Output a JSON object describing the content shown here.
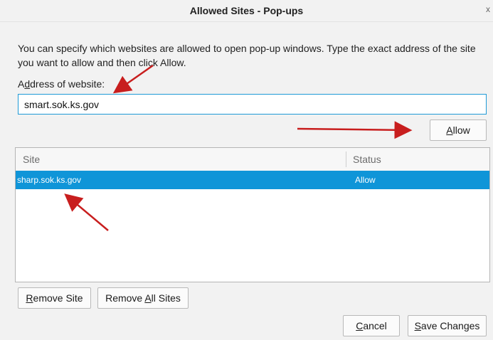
{
  "window": {
    "title": "Allowed Sites - Pop-ups",
    "close_glyph": "x"
  },
  "dialog": {
    "description": "You can specify which websites are allowed to open pop-up windows. Type the exact address of the site you want to allow and then click Allow.",
    "address_label": "Address of website:",
    "address_value": "smart.sok.ks.gov",
    "allow_button": "Allow"
  },
  "table": {
    "columns": [
      "Site",
      "Status"
    ],
    "rows": [
      {
        "site": "sharp.sok.ks.gov",
        "status": "Allow"
      }
    ]
  },
  "buttons": {
    "remove_site": "Remove Site",
    "remove_all_sites": "Remove All Sites",
    "cancel": "Cancel",
    "save_changes": "Save Changes"
  },
  "colors": {
    "accent": "#0f95d8",
    "annotation_arrow": "#c81e1e"
  },
  "icons": [
    "close-icon",
    "annotation-arrow-icon"
  ]
}
